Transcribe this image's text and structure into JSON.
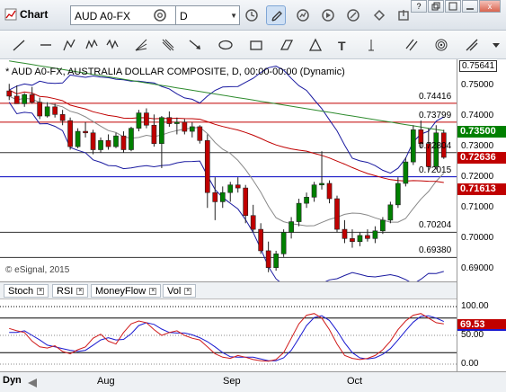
{
  "window": {
    "title": "Chart",
    "minimize": "?",
    "maximize": "",
    "restore": "",
    "close": "x"
  },
  "toolbar": {
    "symbol": "AUD A0-FX",
    "interval": "D",
    "icons": [
      "settings-icon",
      "clock-icon",
      "pencil-icon",
      "gauge-icon",
      "play-icon",
      "link-icon",
      "tag-icon"
    ]
  },
  "drawtools": [
    "line-icon",
    "horizontal-line-icon",
    "pitchfork-icon",
    "zigzag-icon",
    "fan-icon",
    "gann-icon",
    "arrow-icon",
    "ellipse-icon",
    "rectangle-icon",
    "diamond-icon",
    "triangle-icon",
    "text-icon",
    "parallel-icon",
    "cycle-icon",
    "fibonacci-icon",
    "more-icon"
  ],
  "chart": {
    "title": "* AUD A0-FX, AUSTRALIA DOLLAR COMPOSITE, D, 00:00-00:00 (Dynamic)",
    "watermark": "© eSignal, 2015",
    "levels": [
      {
        "label": "0.74416",
        "value": 0.74416,
        "color": "#c00000"
      },
      {
        "label": "0.73799",
        "value": 0.73799,
        "color": "#c00000"
      },
      {
        "label": "0.72804",
        "value": 0.72804,
        "color": "#333333"
      },
      {
        "label": "0.72015",
        "value": 0.72015,
        "color": "#0000c0"
      },
      {
        "label": "0.70204",
        "value": 0.70204,
        "color": "#333333"
      },
      {
        "label": "0.69380",
        "value": 0.6938,
        "color": "#333333"
      }
    ],
    "price_axis": [
      "0.75641",
      "0.75000",
      "0.74000",
      "0.73000",
      "0.72000",
      "0.71000",
      "0.70000",
      "0.69000"
    ],
    "flags": [
      {
        "label": "0.73500",
        "value": 0.735,
        "color": "#008000"
      },
      {
        "label": "0.72636",
        "value": 0.72636,
        "color": "#c00000"
      },
      {
        "label": "0.71613",
        "value": 0.71613,
        "color": "#c00000"
      }
    ],
    "top_price": "0.75641"
  },
  "indicator_tabs": [
    "Stoch",
    "RSI",
    "MoneyFlow",
    "Vol"
  ],
  "oscillator": {
    "axis": [
      "100.00",
      "50.00",
      "0.00"
    ],
    "flag": "69.53",
    "flag_value": 69.53
  },
  "time_axis": {
    "mode": "Dyn",
    "labels": [
      "Aug",
      "Sep",
      "Oct"
    ]
  },
  "chart_data": {
    "type": "candlestick",
    "title": "* AUD A0-FX, AUSTRALIA DOLLAR COMPOSITE, D, 00:00-00:00 (Dynamic)",
    "ylim": [
      0.686,
      0.7585
    ],
    "candles": [
      [
        0.7482,
        0.7505,
        0.7452,
        0.7465
      ],
      [
        0.7465,
        0.75,
        0.744,
        0.744
      ],
      [
        0.744,
        0.7475,
        0.743,
        0.747
      ],
      [
        0.747,
        0.7495,
        0.744,
        0.7445
      ],
      [
        0.7445,
        0.746,
        0.739,
        0.74
      ],
      [
        0.74,
        0.7445,
        0.7395,
        0.743
      ],
      [
        0.743,
        0.744,
        0.7395,
        0.7405
      ],
      [
        0.7405,
        0.742,
        0.737,
        0.7385
      ],
      [
        0.7385,
        0.7395,
        0.729,
        0.73
      ],
      [
        0.73,
        0.736,
        0.7295,
        0.735
      ],
      [
        0.735,
        0.738,
        0.733,
        0.7345
      ],
      [
        0.7345,
        0.7355,
        0.7275,
        0.729
      ],
      [
        0.729,
        0.733,
        0.728,
        0.732
      ],
      [
        0.732,
        0.734,
        0.729,
        0.73
      ],
      [
        0.73,
        0.7345,
        0.7295,
        0.7335
      ],
      [
        0.7335,
        0.735,
        0.728,
        0.729
      ],
      [
        0.729,
        0.7365,
        0.7285,
        0.736
      ],
      [
        0.736,
        0.742,
        0.735,
        0.741
      ],
      [
        0.741,
        0.7425,
        0.736,
        0.737
      ],
      [
        0.737,
        0.7405,
        0.73,
        0.731
      ],
      [
        0.731,
        0.74,
        0.723,
        0.7395
      ],
      [
        0.7395,
        0.7415,
        0.7365,
        0.7375
      ],
      [
        0.7375,
        0.7395,
        0.734,
        0.738
      ],
      [
        0.738,
        0.739,
        0.734,
        0.735
      ],
      [
        0.735,
        0.738,
        0.733,
        0.7365
      ],
      [
        0.7365,
        0.737,
        0.731,
        0.732
      ],
      [
        0.732,
        0.734,
        0.71,
        0.715
      ],
      [
        0.715,
        0.72,
        0.706,
        0.712
      ],
      [
        0.712,
        0.717,
        0.71,
        0.715
      ],
      [
        0.715,
        0.7185,
        0.712,
        0.7175
      ],
      [
        0.7175,
        0.72,
        0.715,
        0.7165
      ],
      [
        0.7165,
        0.7175,
        0.705,
        0.7075
      ],
      [
        0.7075,
        0.711,
        0.702,
        0.703
      ],
      [
        0.703,
        0.705,
        0.695,
        0.696
      ],
      [
        0.696,
        0.699,
        0.689,
        0.6905
      ],
      [
        0.6905,
        0.696,
        0.6895,
        0.695
      ],
      [
        0.695,
        0.703,
        0.694,
        0.702
      ],
      [
        0.702,
        0.707,
        0.7,
        0.7055
      ],
      [
        0.7055,
        0.713,
        0.704,
        0.7115
      ],
      [
        0.7115,
        0.715,
        0.71,
        0.7135
      ],
      [
        0.7135,
        0.7185,
        0.712,
        0.7175
      ],
      [
        0.7175,
        0.7285,
        0.716,
        0.718
      ],
      [
        0.718,
        0.719,
        0.7115,
        0.713
      ],
      [
        0.713,
        0.714,
        0.702,
        0.703
      ],
      [
        0.703,
        0.706,
        0.6985,
        0.7
      ],
      [
        0.7,
        0.703,
        0.697,
        0.699
      ],
      [
        0.699,
        0.702,
        0.6975,
        0.701
      ],
      [
        0.701,
        0.703,
        0.699,
        0.7
      ],
      [
        0.7,
        0.704,
        0.6985,
        0.7025
      ],
      [
        0.7025,
        0.707,
        0.7015,
        0.706
      ],
      [
        0.706,
        0.712,
        0.705,
        0.711
      ],
      [
        0.711,
        0.72,
        0.71,
        0.718
      ],
      [
        0.718,
        0.7265,
        0.717,
        0.725
      ],
      [
        0.725,
        0.737,
        0.724,
        0.7355
      ],
      [
        0.7355,
        0.7385,
        0.7295,
        0.731
      ],
      [
        0.731,
        0.736,
        0.722,
        0.7235
      ],
      [
        0.7235,
        0.737,
        0.7225,
        0.7345
      ],
      [
        0.7345,
        0.7355,
        0.726,
        0.7265
      ]
    ],
    "stoch_k": [
      62,
      58,
      55,
      40,
      30,
      28,
      32,
      22,
      18,
      25,
      30,
      45,
      52,
      40,
      35,
      55,
      70,
      75,
      72,
      60,
      50,
      55,
      58,
      50,
      45,
      42,
      30,
      18,
      12,
      10,
      15,
      12,
      8,
      6,
      5,
      8,
      20,
      45,
      70,
      85,
      88,
      80,
      60,
      35,
      15,
      10,
      8,
      10,
      15,
      25,
      40,
      60,
      75,
      85,
      88,
      80,
      72,
      70
    ],
    "stoch_d": [
      55,
      55,
      58,
      50,
      42,
      33,
      30,
      27,
      24,
      22,
      24,
      33,
      42,
      46,
      42,
      43,
      53,
      67,
      72,
      69,
      61,
      55,
      54,
      54,
      51,
      46,
      39,
      30,
      20,
      13,
      12,
      12,
      12,
      9,
      6,
      6,
      11,
      24,
      45,
      67,
      81,
      84,
      76,
      58,
      37,
      20,
      11,
      9,
      11,
      17,
      27,
      42,
      58,
      73,
      83,
      84,
      80,
      74
    ]
  }
}
